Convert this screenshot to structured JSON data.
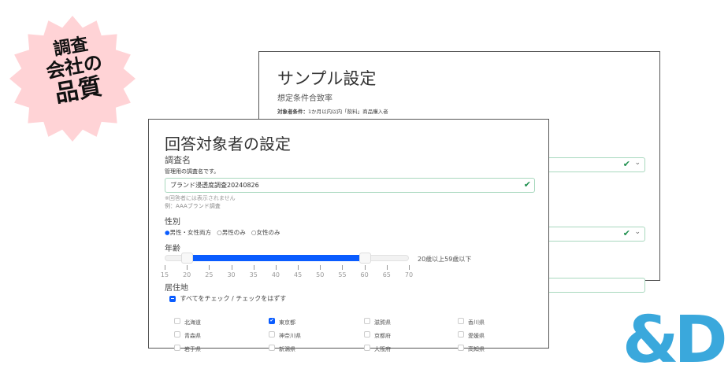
{
  "badge": {
    "lines": [
      "調査",
      "会社の",
      "品質"
    ],
    "color": "#ffd3d6"
  },
  "logo": {
    "text": "&D",
    "color": "#3aa8dc"
  },
  "back_window": {
    "title": "サンプル設定",
    "section": "想定条件合致率",
    "condition_label": "対象者条件：",
    "condition_value": "1か月以内以内「飲料」商品購入者"
  },
  "front_window": {
    "title": "回答対象者の設定",
    "survey_name": {
      "label": "調査名",
      "help": "管理用の調査名です。",
      "value": "ブランド浸透度調査20240826",
      "note1": "※回答者には表示されません",
      "note2": "例：AAAブランド調査"
    },
    "gender": {
      "label": "性別",
      "options": [
        "男性・女性両方",
        "男性のみ",
        "女性のみ"
      ],
      "selected": 0
    },
    "age": {
      "label": "年齢",
      "min": 20,
      "max": 59,
      "range": [
        15,
        70
      ],
      "ticks": [
        "15",
        "20",
        "25",
        "30",
        "35",
        "40",
        "45",
        "50",
        "55",
        "60",
        "65",
        "70"
      ],
      "summary": "20歳以上59歳以下",
      "accent": "#0a5cff"
    },
    "residence": {
      "label": "居住地",
      "check_all": "すべてをチェック / チェックをはずす",
      "prefectures": [
        [
          {
            "name": "北海道",
            "checked": false
          },
          {
            "name": "東京都",
            "checked": true
          },
          {
            "name": "滋賀県",
            "checked": false
          },
          {
            "name": "香川県",
            "checked": false
          }
        ],
        [
          {
            "name": "青森県",
            "checked": false
          },
          {
            "name": "神奈川県",
            "checked": false
          },
          {
            "name": "京都府",
            "checked": false
          },
          {
            "name": "愛媛県",
            "checked": false
          }
        ],
        [
          {
            "name": "岩手県",
            "checked": false
          },
          {
            "name": "新潟県",
            "checked": false
          },
          {
            "name": "大阪府",
            "checked": false
          },
          {
            "name": "高知県",
            "checked": false
          }
        ]
      ]
    }
  }
}
